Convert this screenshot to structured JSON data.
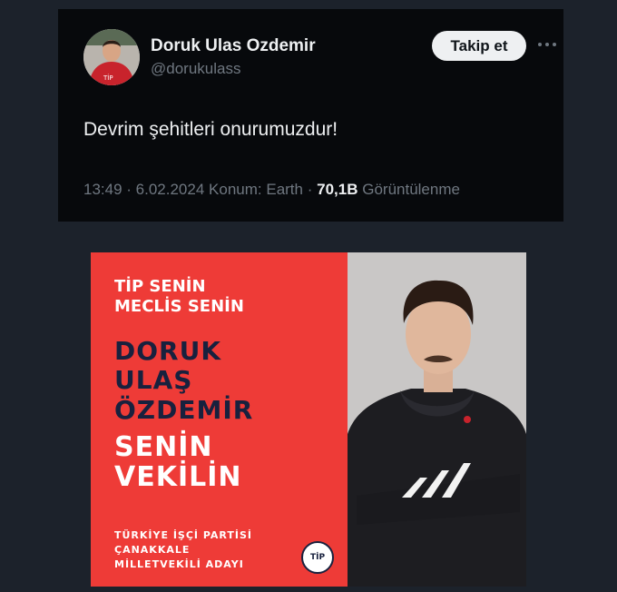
{
  "tweet": {
    "display_name": "Doruk Ulas Ozdemir",
    "handle": "@dorukulass",
    "follow_label": "Takip et",
    "text": "Devrim şehitleri onurumuzdur!",
    "time": "13:49",
    "date": "6.02.2024",
    "location": "Konum: Earth",
    "views_count": "70,1B",
    "views_label": "Görüntülenme"
  },
  "poster": {
    "line1": "TİP SENİN",
    "line2": "MECLİS SENİN",
    "name1": "DORUK",
    "name2": "ULAŞ",
    "name3": "ÖZDEMİR",
    "slogan1": "SENİN",
    "slogan2": "VEKİLİN",
    "party": "TÜRKİYE İŞÇİ PARTİSİ",
    "city": "ÇANAKKALE",
    "role": "MİLLETVEKİLİ ADAYI",
    "logo_text": "TİP"
  },
  "colors": {
    "tweet_bg": "#07090c",
    "page_bg": "#1c222b",
    "poster_red": "#ee3b37",
    "poster_navy": "#18213e"
  },
  "icons": {
    "more": "more-horizontal-icon"
  }
}
